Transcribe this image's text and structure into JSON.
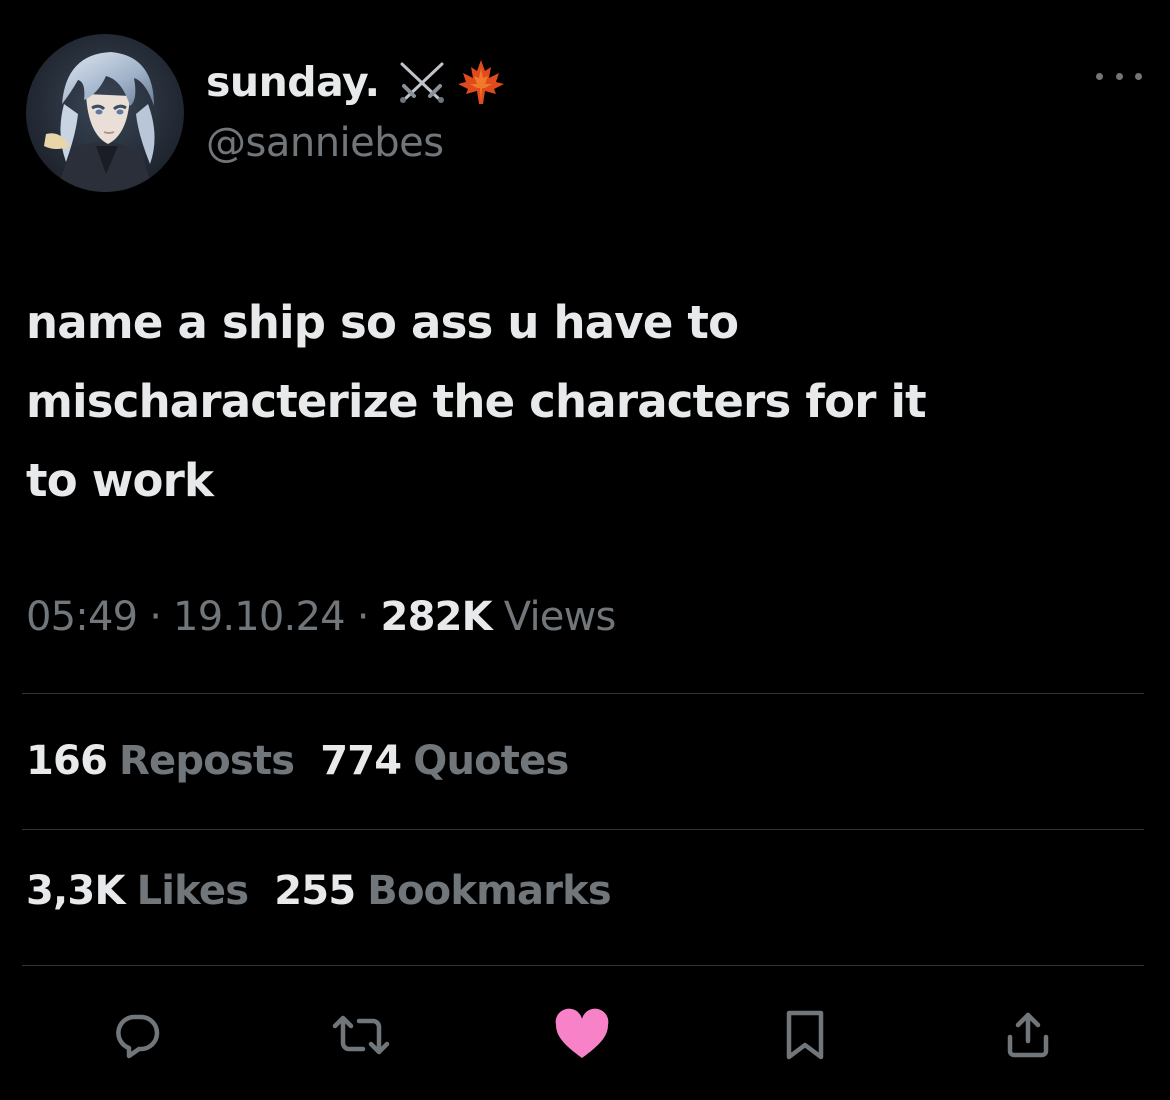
{
  "author": {
    "display_name": "sunday.",
    "name_emojis": [
      "crossed-swords-emoji",
      "maple-leaf-emoji"
    ],
    "handle": "@sanniebes",
    "avatar": "anime-character-avatar"
  },
  "tweet": {
    "text_lines": [
      "name a ship so ass u have to",
      "mischaracterize the characters for it",
      "to work"
    ]
  },
  "meta": {
    "time": "05:49",
    "separator": "·",
    "date": "19.10.24",
    "views_count": "282K",
    "views_label": "Views"
  },
  "stats": {
    "reposts_count": "166",
    "reposts_label": "Reposts",
    "quotes_count": "774",
    "quotes_label": "Quotes",
    "likes_count": "3,3K",
    "likes_label": "Likes",
    "bookmarks_count": "255",
    "bookmarks_label": "Bookmarks"
  },
  "actions": [
    "reply-icon",
    "repost-icon",
    "like-icon",
    "bookmark-icon",
    "share-icon"
  ],
  "colors": {
    "background": "#000000",
    "primary_text": "#e7e9ea",
    "secondary_text": "#71767b",
    "divider": "#2f3336",
    "like_active": "#f91880"
  }
}
